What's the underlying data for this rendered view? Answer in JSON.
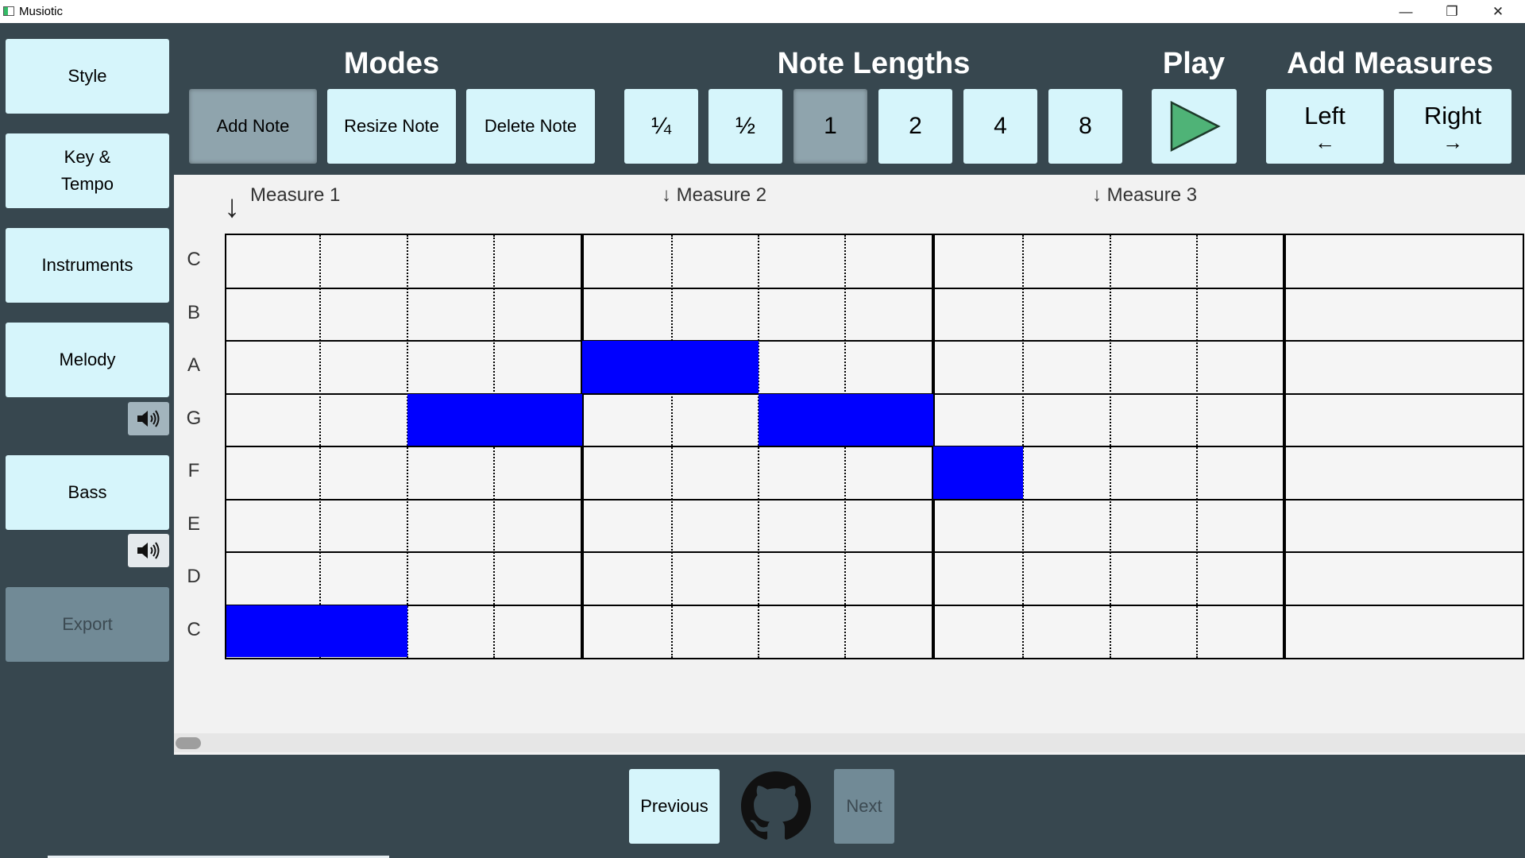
{
  "window": {
    "title": "Musiotic",
    "minimize": "—",
    "restore": "❐",
    "close": "✕"
  },
  "sidebar": {
    "style": "Style",
    "key_line1": "Key &",
    "key_line2": "Tempo",
    "instruments": "Instruments",
    "melody": "Melody",
    "bass": "Bass",
    "export": "Export",
    "mute_icon": "speaker-icon"
  },
  "toolbar": {
    "modes_header": "Modes",
    "add_note": "Add Note",
    "resize_note": "Resize Note",
    "delete_note": "Delete Note",
    "note_lengths_header": "Note Lengths",
    "lengths": [
      "¼",
      "½",
      "1",
      "2",
      "4",
      "8"
    ],
    "selected_mode": "Add Note",
    "selected_length": "1",
    "play_header": "Play",
    "add_measures_header": "Add Measures",
    "left": "Left",
    "left_arrow": "←",
    "right": "Right",
    "right_arrow": "→"
  },
  "editor": {
    "measure_labels": [
      "Measure 1",
      "↓ Measure 2",
      "↓ Measure 3"
    ],
    "big_arrow": "↓",
    "rows": [
      "C",
      "B",
      "A",
      "G",
      "F",
      "E",
      "D",
      "C"
    ],
    "beats_per_measure": 4,
    "measures": 3,
    "note_color": "#0000ff",
    "notes": [
      {
        "row": 2,
        "start": 4,
        "length": 1
      },
      {
        "row": 2,
        "start": 5,
        "length": 1
      },
      {
        "row": 3,
        "start": 2,
        "length": 1
      },
      {
        "row": 3,
        "start": 3,
        "length": 1
      },
      {
        "row": 3,
        "start": 6,
        "length": 2
      },
      {
        "row": 4,
        "start": 8,
        "length": 1
      },
      {
        "row": 7,
        "start": 0,
        "length": 1
      },
      {
        "row": 7,
        "start": 1,
        "length": 1
      }
    ]
  },
  "nav": {
    "previous": "Previous",
    "next": "Next",
    "github_icon": "github-icon"
  },
  "colors": {
    "background": "#37474f",
    "button": "#d6f5fb",
    "button_disabled": "#718a96",
    "play_triangle": "#4fb377"
  }
}
